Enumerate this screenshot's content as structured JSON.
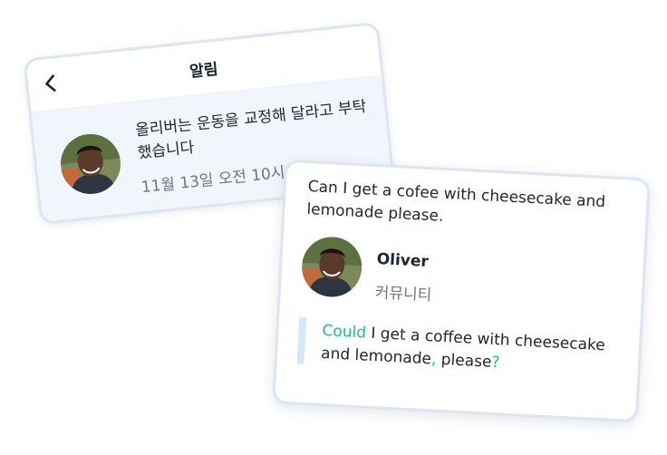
{
  "notification": {
    "title": "알림",
    "message": "올리버는 운동을 교정해 달라고 부탁했습니다",
    "timestamp": "11월 13일 오전 10시"
  },
  "correction": {
    "original_text": "Can I get a cofee with cheesecake and lemonade please.",
    "user": {
      "name": "Oliver",
      "role": "커뮤니티"
    },
    "corrected": {
      "seg1_highlight": "Could",
      "seg2": " I get a cof",
      "seg3_highlight": "f",
      "seg4": "ee with cheesecake and lemonade",
      "seg5_highlight": ",",
      "seg6": " please",
      "seg7_highlight": "?"
    }
  },
  "icons": {
    "back": "chevron-left-icon"
  },
  "colors": {
    "highlight": "#1fb98a",
    "card_border": "#dde5ef",
    "notification_bg": "#f1f6fd",
    "quote_bar": "#d4e8fb"
  }
}
